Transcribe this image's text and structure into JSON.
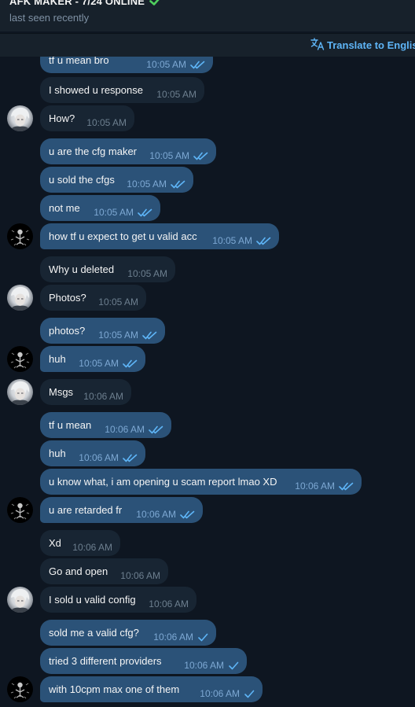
{
  "header": {
    "title": "AFK MAKER - 7/24 ONLINE",
    "status": "last seen recently"
  },
  "translate_bar": {
    "label": "Translate to Englis"
  },
  "colors": {
    "background": "#0e1621",
    "incoming_bubble": "#182533",
    "outgoing_bubble": "#2b5278",
    "accent": "#5eb5f7",
    "verified": "#4fce5d"
  },
  "icons": {
    "verified": "verified-check-icon",
    "translate": "translate-icon",
    "read_receipt": "double-check-icon",
    "sent_receipt": "single-check-icon"
  },
  "messages": [
    {
      "text": "tf u mean bro",
      "time": "10:05 AM",
      "direction": "out",
      "status": "read"
    },
    {
      "text": "I showed u response",
      "time": "10:05 AM",
      "direction": "in"
    },
    {
      "text": "How?",
      "time": "10:05 AM",
      "direction": "in",
      "avatar": "light"
    },
    {
      "text": "u are the cfg maker",
      "time": "10:05 AM",
      "direction": "out",
      "status": "read"
    },
    {
      "text": "u sold the cfgs",
      "time": "10:05 AM",
      "direction": "out",
      "status": "read"
    },
    {
      "text": "not me",
      "time": "10:05 AM",
      "direction": "out",
      "status": "read"
    },
    {
      "text": "how tf u expect to get u valid acc",
      "time": "10:05 AM",
      "direction": "out",
      "status": "read",
      "avatar": "dark"
    },
    {
      "text": "Why u deleted",
      "time": "10:05 AM",
      "direction": "in"
    },
    {
      "text": "Photos?",
      "time": "10:05 AM",
      "direction": "in",
      "avatar": "light"
    },
    {
      "text": "photos?",
      "time": "10:05 AM",
      "direction": "out",
      "status": "read"
    },
    {
      "text": "huh",
      "time": "10:05 AM",
      "direction": "out",
      "status": "read",
      "avatar": "dark"
    },
    {
      "text": "Msgs",
      "time": "10:06 AM",
      "direction": "in",
      "avatar": "light"
    },
    {
      "text": "tf u mean",
      "time": "10:06 AM",
      "direction": "out",
      "status": "read"
    },
    {
      "text": "huh",
      "time": "10:06 AM",
      "direction": "out",
      "status": "read"
    },
    {
      "text": "u know what, i am opening u scam report lmao XD",
      "time": "10:06 AM",
      "direction": "out",
      "status": "read"
    },
    {
      "text": "u are retarded fr",
      "time": "10:06 AM",
      "direction": "out",
      "status": "read",
      "avatar": "dark"
    },
    {
      "text": "Xd",
      "time": "10:06 AM",
      "direction": "in"
    },
    {
      "text": "Go and open",
      "time": "10:06 AM",
      "direction": "in"
    },
    {
      "text": "I sold u valid config",
      "time": "10:06 AM",
      "direction": "in",
      "avatar": "light"
    },
    {
      "text": "sold me a valid cfg?",
      "time": "10:06 AM",
      "direction": "out",
      "status": "sent"
    },
    {
      "text": "tried 3 different providers",
      "time": "10:06 AM",
      "direction": "out",
      "status": "sent"
    },
    {
      "text": "with 10cpm max one of them",
      "time": "10:06 AM",
      "direction": "out",
      "status": "sent",
      "avatar": "dark"
    }
  ]
}
